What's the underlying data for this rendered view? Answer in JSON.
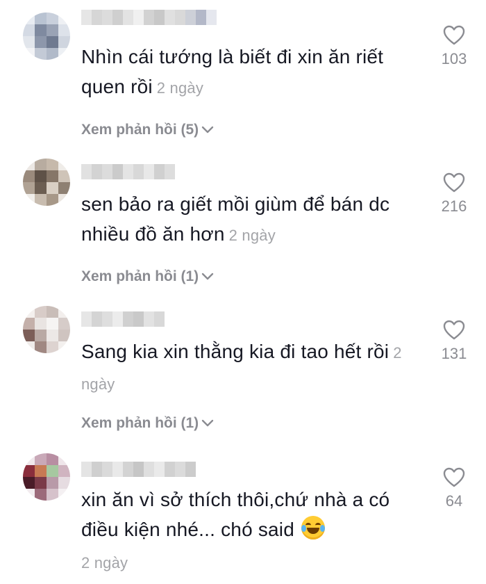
{
  "comments": [
    {
      "username": "",
      "text": "Nhìn cái tướng là biết đi xin ăn riết quen rồi",
      "date": "2 ngày",
      "replies": "Xem phản hồi (5)",
      "likes": "103"
    },
    {
      "username": "",
      "text": "sen bảo ra giết mồi giùm để bán dc nhiều đồ ăn hơn",
      "date": "2 ngày",
      "replies": "Xem phản hồi (1)",
      "likes": "216"
    },
    {
      "username": "",
      "text": "Sang kia xin thằng kia đi tao hết rồi",
      "date": "2 ngày",
      "replies": "Xem phản hồi (1)",
      "likes": "131"
    },
    {
      "username": "",
      "text": "xin ăn vì sở thích thôi,chứ nhà a có điều kiện nhé... chó said",
      "emoji": "laughing-tears-emoji",
      "date": "2 ngày",
      "likes": "64"
    }
  ],
  "icons": {
    "like": "heart-outline-icon",
    "expand": "chevron-down-icon"
  },
  "colors": {
    "text": "#161823",
    "muted": "#8a8b91",
    "date": "#a3a4a8"
  }
}
